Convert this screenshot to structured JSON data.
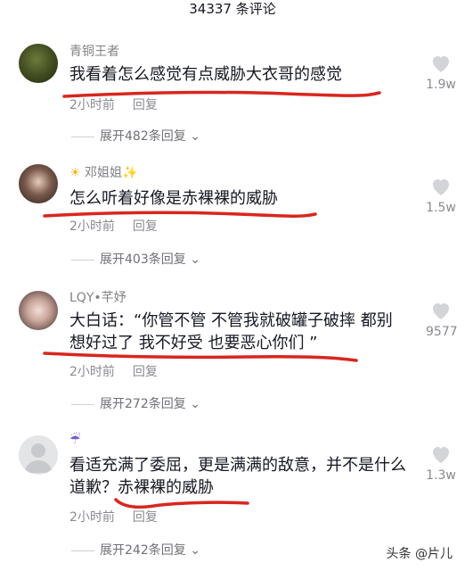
{
  "header": {
    "title": "34337 条评论"
  },
  "comments": [
    {
      "user": "青铜王者",
      "text": "我看着怎么感觉有点威胁大衣哥的感觉",
      "time": "2小时前",
      "reply": "回复",
      "expand": "展开482条回复",
      "likes": "1.9w"
    },
    {
      "user_prefix": "☀",
      "user": "邓姐姐",
      "user_suffix": "✨",
      "text": "怎么听着好像是赤裸裸的威胁",
      "time": "2小时前",
      "reply": "回复",
      "expand": "展开403条回复",
      "likes": "1.5w"
    },
    {
      "user": "LQY•芊妤",
      "text": "大白话：“你管不管 不管我就破罐子破摔 都别想好过了 我不好受 也要恶心你们 ”",
      "time": "2小时前",
      "reply": "回复",
      "expand": "展开272条回复",
      "likes": "9577"
    },
    {
      "user": "☔",
      "text": "看适充满了委屈，更是满满的敌意，并不是什么道歉？赤裸裸的威胁",
      "time": "2小时前",
      "reply": "回复",
      "expand": "展开242条回复",
      "likes": "1.3w"
    }
  ],
  "watermark": "头条 @片儿",
  "colors": {
    "underline": "#d8261f",
    "secondary_text": "#8a8b91"
  }
}
